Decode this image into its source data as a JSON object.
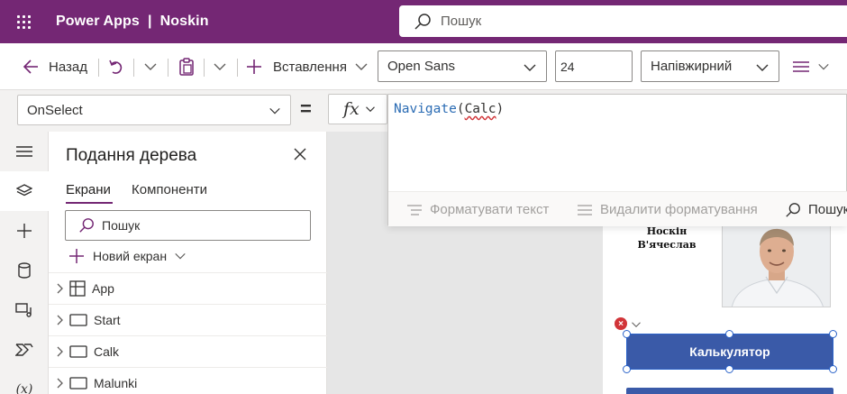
{
  "topbar": {
    "app_title": "Power Apps  |  Noskin",
    "search_placeholder": "Пошук"
  },
  "cmdbar": {
    "back_label": "Назад",
    "insert_label": "Вставлення",
    "font_family": "Open Sans",
    "font_size": "24",
    "font_weight": "Напівжирний"
  },
  "formulabar": {
    "property": "OnSelect",
    "equals": "=",
    "fx": "fx",
    "formula": {
      "function": "Navigate",
      "open": "(",
      "argument": "Calc",
      "close": ")"
    },
    "tools": {
      "format_text": "Форматувати текст",
      "remove_formatting": "Видалити форматування",
      "find": "Пошук"
    }
  },
  "tree": {
    "title": "Подання дерева",
    "tabs": [
      "Екрани",
      "Компоненти"
    ],
    "search_placeholder": "Пошук",
    "new_screen_label": "Новий екран",
    "items": [
      {
        "label": "App",
        "icon": "app-icon"
      },
      {
        "label": "Start",
        "icon": "screen-icon"
      },
      {
        "label": "Calk",
        "icon": "screen-icon"
      },
      {
        "label": "Malunki",
        "icon": "screen-icon"
      }
    ]
  },
  "canvas": {
    "name_line1": "Носкін",
    "name_line2": "В'ячеслав",
    "calc_button_label": "Калькулятор",
    "error_badge": "×"
  },
  "rail": {
    "bottom_label": "(x)"
  },
  "colors": {
    "brand": "#742774",
    "button": "#3a5aa8",
    "selection": "#2b63c9",
    "error": "#d13438"
  }
}
